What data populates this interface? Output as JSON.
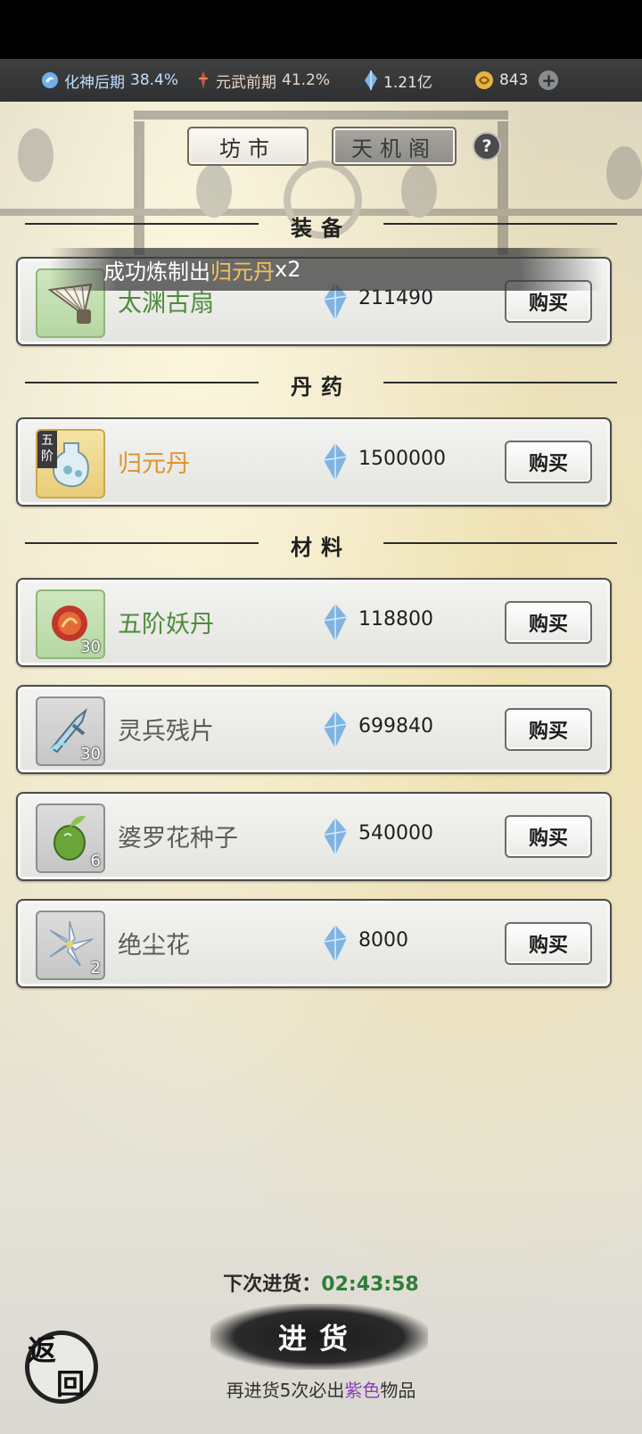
{
  "status_bar": {
    "realm_name": "化神后期",
    "realm_pct": "38.4%",
    "martial_name": "元武前期",
    "martial_pct": "41.2%",
    "spirit_stones": "1.21亿",
    "gold": "843",
    "icons": [
      "realm-orb-icon",
      "martial-flame-icon",
      "spirit-stone-icon",
      "gold-coin-icon",
      "plus-icon"
    ]
  },
  "tabs": {
    "market": "坊市",
    "tianji": "天机阁",
    "help": "?"
  },
  "toast": {
    "prefix": "成功炼制出",
    "item": "归元丹",
    "suffix": "x2"
  },
  "sections": {
    "equipment": "装备",
    "pills": "丹药",
    "materials": "材料"
  },
  "items": [
    {
      "name": "太渊古扇",
      "price": "211490",
      "buy": "购买",
      "name_color": "#4e8a3c",
      "qty": "",
      "tier": "",
      "icon": "fan-icon"
    },
    {
      "name": "归元丹",
      "price": "1500000",
      "buy": "购买",
      "name_color": "#e0952e",
      "qty": "",
      "tier": "五阶",
      "icon": "pill-bottle-icon"
    },
    {
      "name": "五阶妖丹",
      "price": "118800",
      "buy": "购买",
      "name_color": "#4e8a3c",
      "qty": "30",
      "tier": "",
      "icon": "demon-core-icon"
    },
    {
      "name": "灵兵残片",
      "price": "699840",
      "buy": "购买",
      "name_color": "#5b5b5b",
      "qty": "30",
      "tier": "",
      "icon": "weapon-shard-icon"
    },
    {
      "name": "婆罗花种子",
      "price": "540000",
      "buy": "购买",
      "name_color": "#5b5b5b",
      "qty": "6",
      "tier": "",
      "icon": "seed-icon"
    },
    {
      "name": "绝尘花",
      "price": "8000",
      "buy": "购买",
      "name_color": "#5b5b5b",
      "qty": "2",
      "tier": "",
      "icon": "lily-flower-icon"
    }
  ],
  "restock": {
    "timer_label": "下次进货：",
    "timer_value": "02:43:58",
    "button": "进货",
    "note_prefix": "再进货5次必出",
    "note_highlight": "紫色",
    "note_suffix": "物品"
  },
  "back_button": {
    "char1": "返",
    "char2": "回"
  }
}
